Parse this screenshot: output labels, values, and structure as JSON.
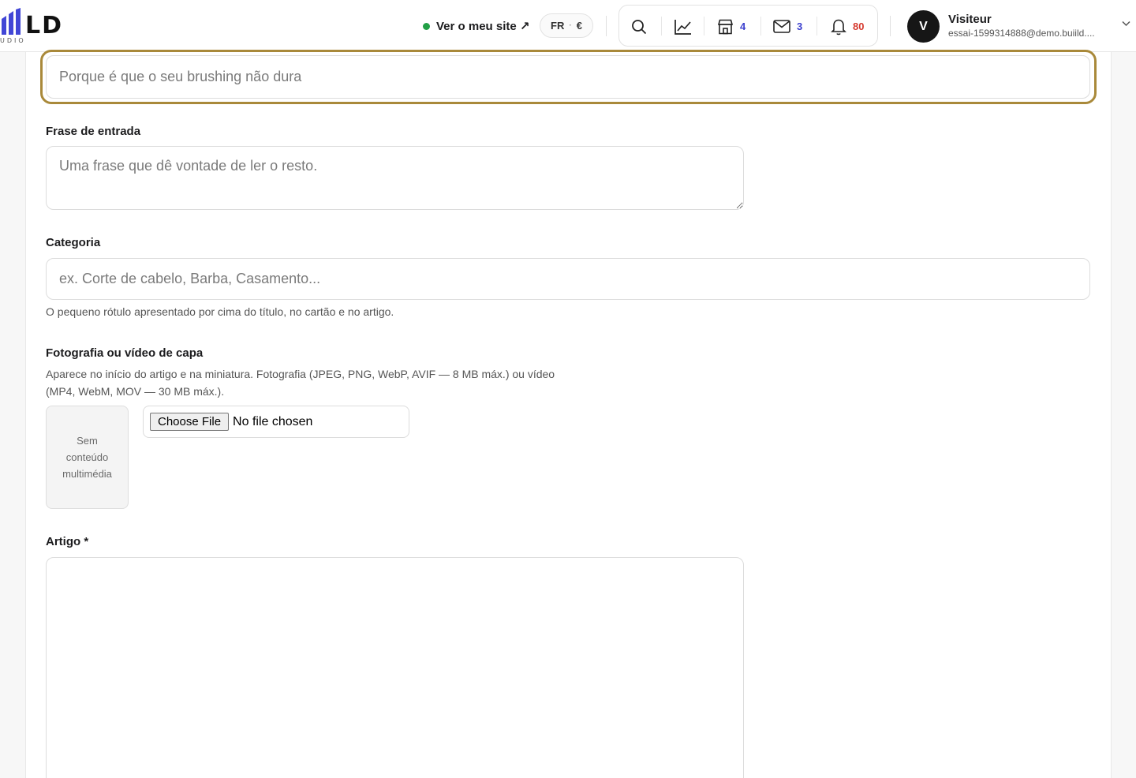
{
  "brand": {
    "logo_text": "LD",
    "logo_subtext": "UDIO",
    "accent_color": "#4146d6"
  },
  "header": {
    "site_link_label": "Ver o meu site ↗",
    "site_status_color": "#22a046",
    "language": "FR",
    "currency": "€",
    "icons": [
      {
        "name": "search-icon"
      },
      {
        "name": "analytics-icon"
      },
      {
        "name": "store-icon",
        "count": "4"
      },
      {
        "name": "mail-icon",
        "count": "3"
      },
      {
        "name": "bell-icon",
        "count": "80"
      }
    ],
    "user": {
      "initial": "V",
      "name": "Visiteur",
      "email": "essai-1599314888@demo.buiild...."
    }
  },
  "form": {
    "title_input": {
      "placeholder": "Porque é que o seu brushing não dura",
      "focus_color": "#a9893a"
    },
    "intro": {
      "label": "Frase de entrada",
      "placeholder": "Uma frase que dê vontade de ler o resto."
    },
    "category": {
      "label": "Categoria",
      "placeholder": "ex. Corte de cabelo, Barba, Casamento...",
      "help": "O pequeno rótulo apresentado por cima do título, no cartão e no artigo."
    },
    "cover": {
      "label": "Fotografia ou vídeo de capa",
      "help_line1": "Aparece no início do artigo e na miniatura. Fotografia (JPEG, PNG, WebP, AVIF — 8 MB máx.) ou vídeo",
      "help_line2": "(MP4, WebM, MOV — 30 MB máx.).",
      "empty_preview": "Sem conteúdo multimédia",
      "file_button": "Choose File",
      "file_status": "No file chosen"
    },
    "article": {
      "label": "Artigo *"
    }
  }
}
